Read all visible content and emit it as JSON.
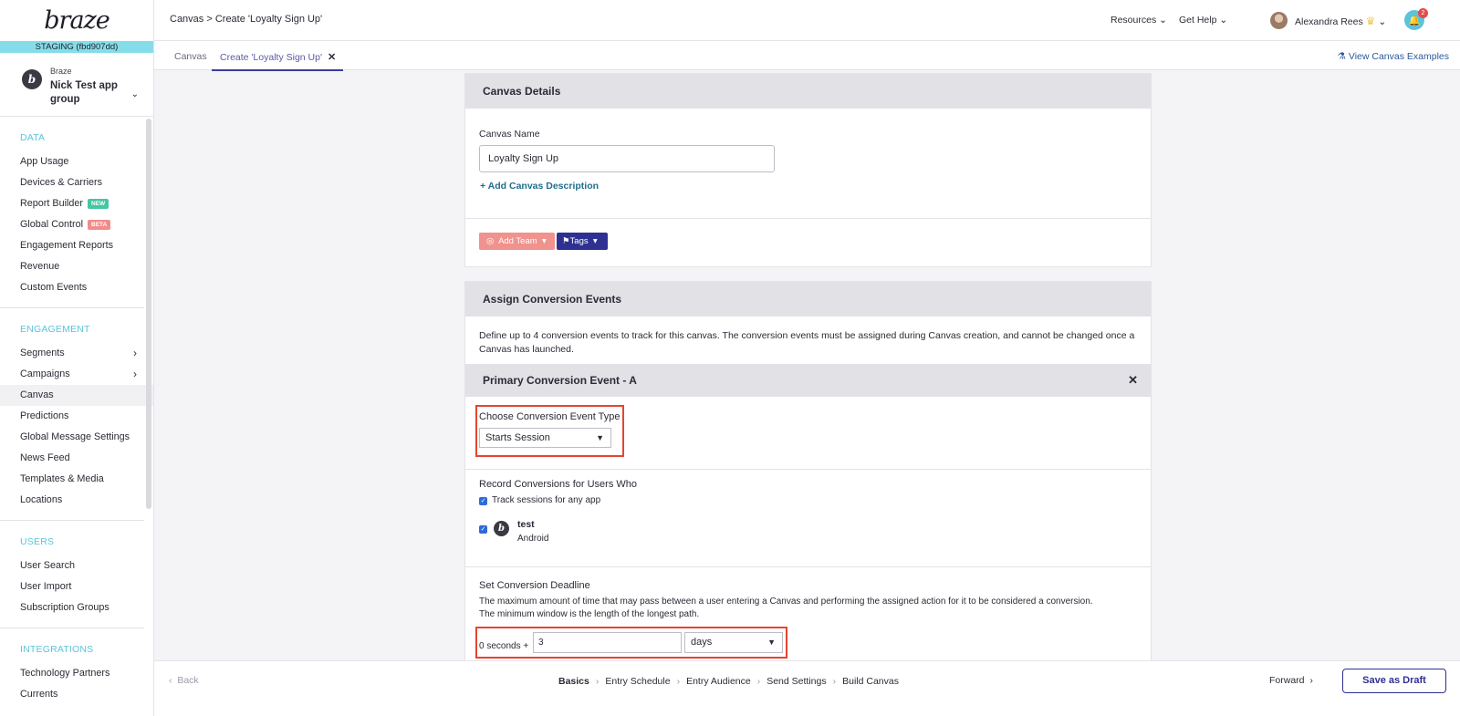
{
  "brand": {
    "logo": "braze",
    "environment": "STAGING (fbd907dd)"
  },
  "app_group": {
    "company": "Braze",
    "name": "Nick Test app group"
  },
  "sidebar": {
    "sections": [
      {
        "title": "DATA",
        "items": [
          {
            "label": "App Usage"
          },
          {
            "label": "Devices & Carriers"
          },
          {
            "label": "Report Builder",
            "badge": "NEW"
          },
          {
            "label": "Global Control",
            "badge": "BETA"
          },
          {
            "label": "Engagement Reports"
          },
          {
            "label": "Revenue"
          },
          {
            "label": "Custom Events"
          }
        ]
      },
      {
        "title": "ENGAGEMENT",
        "items": [
          {
            "label": "Segments",
            "chevron": true
          },
          {
            "label": "Campaigns",
            "chevron": true
          },
          {
            "label": "Canvas",
            "active": true
          },
          {
            "label": "Predictions"
          },
          {
            "label": "Global Message Settings"
          },
          {
            "label": "News Feed"
          },
          {
            "label": "Templates & Media"
          },
          {
            "label": "Locations"
          }
        ]
      },
      {
        "title": "USERS",
        "items": [
          {
            "label": "User Search"
          },
          {
            "label": "User Import"
          },
          {
            "label": "Subscription Groups"
          }
        ]
      },
      {
        "title": "INTEGRATIONS",
        "items": [
          {
            "label": "Technology Partners"
          },
          {
            "label": "Currents"
          }
        ]
      }
    ]
  },
  "header": {
    "breadcrumb": "Canvas > Create 'Loyalty Sign Up'",
    "resources": "Resources",
    "get_help": "Get Help",
    "user_name": "Alexandra Rees",
    "notification_count": "2"
  },
  "tabs": {
    "items": [
      {
        "label": "Canvas"
      },
      {
        "label": "Create 'Loyalty Sign Up'"
      }
    ],
    "view_examples": "View Canvas Examples"
  },
  "canvas_details": {
    "title": "Canvas Details",
    "name_label": "Canvas Name",
    "name_value": "Loyalty Sign Up",
    "add_description": "+ Add Canvas Description",
    "add_team": "Add Team",
    "tags": "Tags"
  },
  "conversion": {
    "title": "Assign Conversion Events",
    "description": "Define up to 4 conversion events to track for this canvas. The conversion events must be assigned during Canvas creation, and cannot be changed once a Canvas has launched.",
    "primary_title": "Primary Conversion Event - A",
    "event_type_label": "Choose Conversion Event Type",
    "event_type_value": "Starts Session",
    "record_label": "Record Conversions for Users Who",
    "track_any_app": "Track sessions for any app",
    "app_name": "test",
    "app_platform": "Android",
    "deadline_label": "Set Conversion Deadline",
    "deadline_desc_1": "The maximum amount of time that may pass between a user entering a Canvas and performing the assigned action for it to be considered a conversion.",
    "deadline_desc_2": "The minimum window is the length of the longest path.",
    "deadline_prefix": "0 seconds +",
    "deadline_value": "3",
    "deadline_unit": "days"
  },
  "footer": {
    "back": "Back",
    "steps": [
      "Basics",
      "Entry Schedule",
      "Entry Audience",
      "Send Settings",
      "Build Canvas"
    ],
    "forward": "Forward",
    "save_draft": "Save as Draft"
  }
}
